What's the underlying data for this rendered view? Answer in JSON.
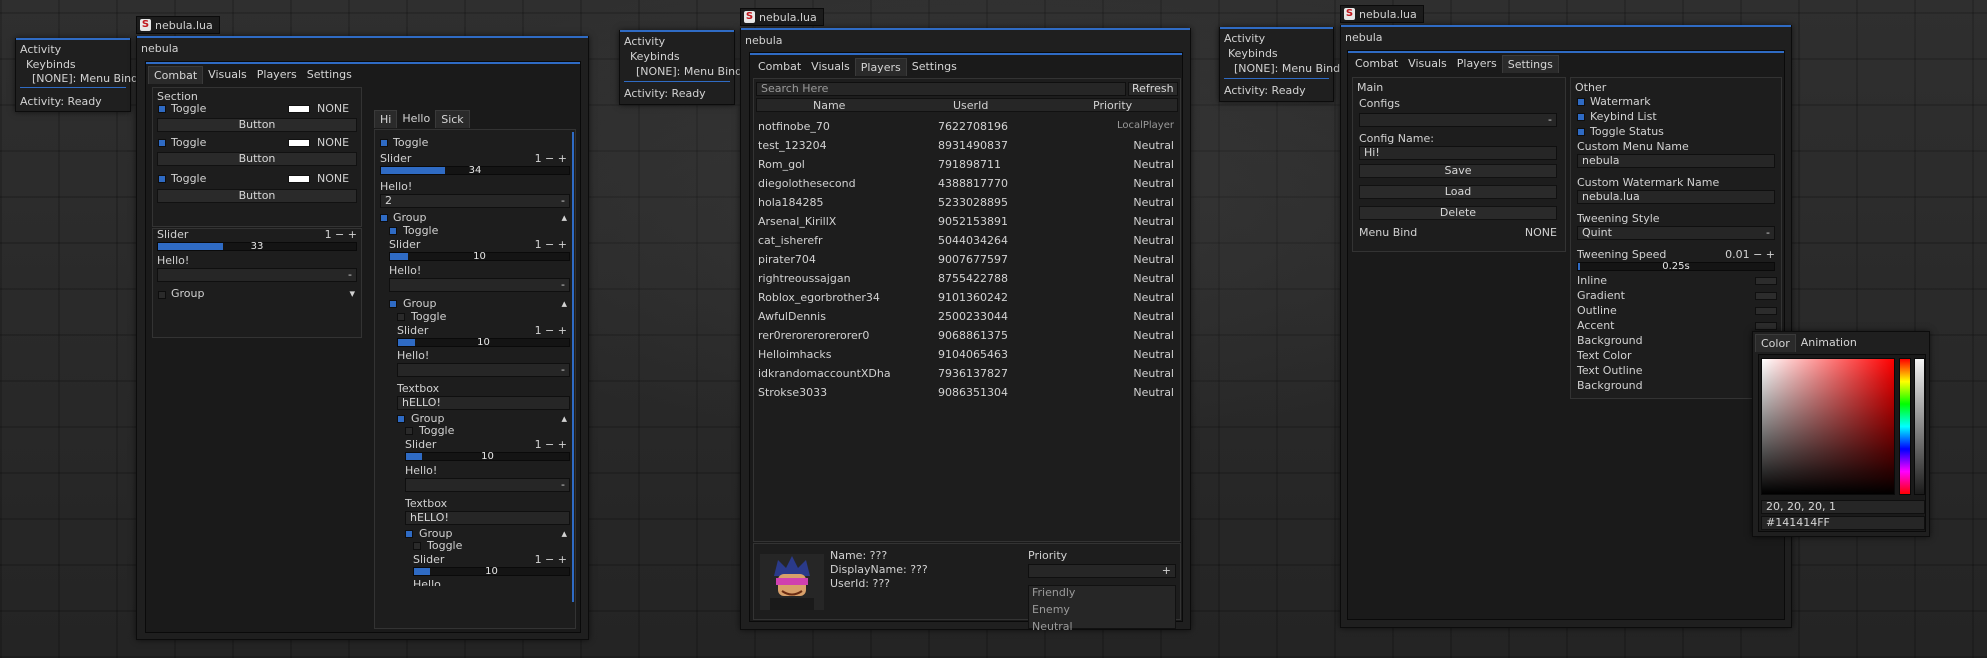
{
  "activity": {
    "title": "Activity",
    "keybinds": "Keybinds",
    "menu_bind": "[NONE]: Menu Bind",
    "status": "Activity: Ready"
  },
  "window_title": "nebula.lua",
  "window_name": "nebula",
  "tabs": [
    "Combat",
    "Visuals",
    "Players",
    "Settings"
  ],
  "combat": {
    "section": "Section",
    "toggle": "Toggle",
    "none": "NONE",
    "button": "Button",
    "slider": "Slider",
    "slider_value": "33",
    "slider_ctrl": "1 − +",
    "hello": "Hello!",
    "group": "Group",
    "dash": "-",
    "arrow": "▾"
  },
  "hi_tabs": [
    "Hi",
    "Hello",
    "Sick"
  ],
  "hi": {
    "toggle": "Toggle",
    "slider": "Slider",
    "slider_ctrl": "1 − +",
    "v34": "34",
    "v10": "10",
    "hello": "Hello!",
    "two": "2",
    "group": "Group",
    "textbox": "Textbox",
    "textbox_value": "hELLO!",
    "up": "▴",
    "dash": "-",
    "cut": "Hello"
  },
  "players": {
    "search": "Search Here",
    "refresh": "Refresh",
    "headers": [
      "Name",
      "UserId",
      "Priority"
    ],
    "rows": [
      [
        "notfinobe_70",
        "7622708196",
        "LocalPlayer"
      ],
      [
        "test_123204",
        "8931490837",
        "Neutral"
      ],
      [
        "Rom_gol",
        "791898711",
        "Neutral"
      ],
      [
        "diegolothesecond",
        "4388817770",
        "Neutral"
      ],
      [
        "hola184285",
        "5233028895",
        "Neutral"
      ],
      [
        "Arsenal_KirillX",
        "9052153891",
        "Neutral"
      ],
      [
        "cat_isherefr",
        "5044034264",
        "Neutral"
      ],
      [
        "pirater704",
        "9007677597",
        "Neutral"
      ],
      [
        "rightreoussajgan",
        "8755422788",
        "Neutral"
      ],
      [
        "Roblox_egorbrother34",
        "9101360242",
        "Neutral"
      ],
      [
        "AwfulDennis",
        "2500233044",
        "Neutral"
      ],
      [
        "rer0rerorerorerorer0",
        "9068861375",
        "Neutral"
      ],
      [
        "Helloimhacks",
        "9104065463",
        "Neutral"
      ],
      [
        "idkrandomaccountXDha",
        "7936137827",
        "Neutral"
      ],
      [
        "Strokse3033",
        "9086351304",
        "Neutral"
      ]
    ],
    "name": "Name: ???",
    "display": "DisplayName: ???",
    "userid": "UserId: ???",
    "priority": "Priority",
    "plus": "+",
    "options": [
      "Friendly",
      "Enemy",
      "Neutral"
    ]
  },
  "settings": {
    "main": "Main",
    "configs": "Configs",
    "config_name": "Config Name:",
    "config_value": "Hi!",
    "save": "Save",
    "load": "Load",
    "delete": "Delete",
    "menu_bind": "Menu Bind",
    "none": "NONE",
    "dash": "-",
    "other": "Other",
    "watermark": "Watermark",
    "keybind_list": "Keybind List",
    "toggle_status": "Toggle Status",
    "custom_menu_name": "Custom Menu Name",
    "menu_name_value": "nebula",
    "custom_watermark_name": "Custom Watermark Name",
    "watermark_value": "nebula.lua",
    "tweening_style": "Tweening Style",
    "tweening_value": "Quint",
    "tweening_speed": "Tweening Speed",
    "speed_ctrl": "0.01 − +",
    "speed_value": "0.25s",
    "colors": [
      "Inline",
      "Gradient",
      "Outline",
      "Accent",
      "Background",
      "Text Color",
      "Text Outline",
      "Background"
    ]
  },
  "colorpicker": {
    "tabs": [
      "Color",
      "Animation"
    ],
    "rgb": "20, 20, 20, 1",
    "hex": "#141414FF"
  }
}
